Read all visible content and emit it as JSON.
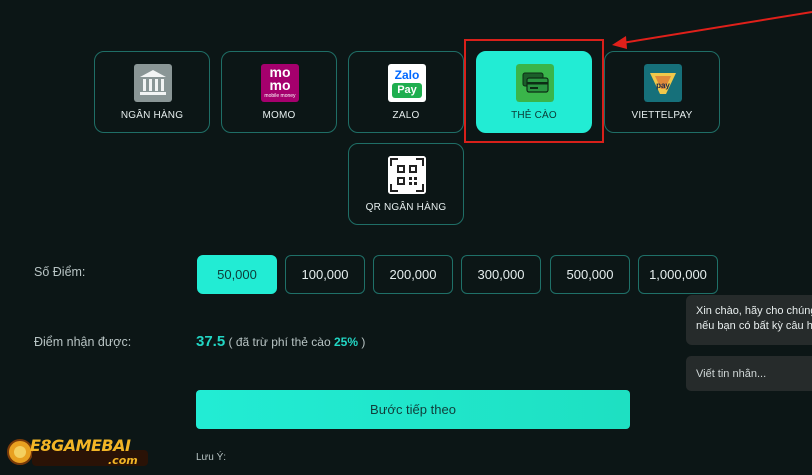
{
  "payment_methods": [
    {
      "label": "NGÂN HÀNG",
      "icon": "bank-icon",
      "active": false
    },
    {
      "label": "MOMO",
      "icon": "momo-icon",
      "active": false
    },
    {
      "label": "ZALO",
      "icon": "zalopay-icon",
      "active": false
    },
    {
      "label": "THẺ CÀO",
      "icon": "card-icon",
      "active": true
    },
    {
      "label": "VIETTELPAY",
      "icon": "viettelpay-icon",
      "active": false
    },
    {
      "label": "QR NGÂN HÀNG",
      "icon": "qr-icon",
      "active": false
    }
  ],
  "icon_text": {
    "momo_line1": "mo",
    "momo_line2": "mo",
    "momo_sub": "mobile money",
    "zalo_top": "Zalo",
    "zalo_bottom": "Pay"
  },
  "points": {
    "label": "Số Điểm:",
    "options": [
      "50,000",
      "100,000",
      "200,000",
      "300,000",
      "500,000",
      "1,000,000"
    ],
    "selected_index": 0
  },
  "received": {
    "label": "Điểm nhận được:",
    "value": "37.5",
    "note_prefix": "( đã trừ phí thẻ cào",
    "fee": "25%",
    "note_suffix": ")"
  },
  "next_button": "Bước tiếp theo",
  "note_label": "Lưu Ý:",
  "chat": {
    "greeting_line1": "Xin chào, hãy cho chúng",
    "greeting_line2": "nếu bạn có bất kỳ câu h",
    "input_placeholder": "Viết tin nhắn..."
  },
  "logo": {
    "text": "E8GAMEBAI",
    "sub": ".com"
  },
  "colors": {
    "accent": "#22ecd4",
    "background": "#0c1616",
    "highlight": "#d8201a",
    "arrow": "#e0201a"
  }
}
